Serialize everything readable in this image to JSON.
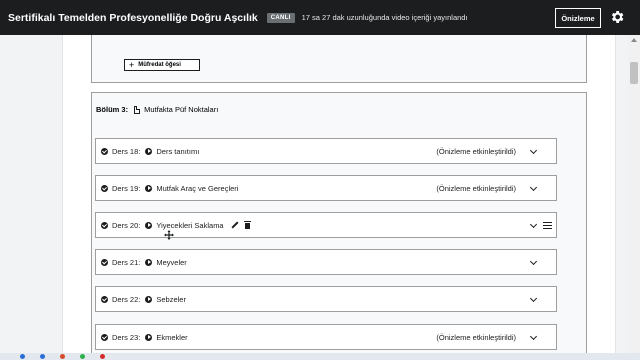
{
  "header": {
    "course_title": "Sertifikalı Temelden Profesyonelliğe Doğru Aşcılık",
    "live_badge": "CANLI",
    "status_text": "17 sa 27 dak uzunluğunda video içeriği yayınlandı",
    "preview_button": "Önizleme",
    "settings_icon": "gear-icon"
  },
  "curriculum": {
    "add_item_label": "Müfredat öğesi",
    "section": {
      "label": "Bölüm 3:",
      "title": "Mutfakta Püf Noktaları"
    },
    "lectures": [
      {
        "label": "Ders 18:",
        "title": "Ders tanıtımı",
        "preview_note": "(Önizleme etkinleştirildi)",
        "expanded_tools": false
      },
      {
        "label": "Ders 19:",
        "title": "Mutfak Araç ve Gereçleri",
        "preview_note": "(Önizleme etkinleştirildi)",
        "expanded_tools": false
      },
      {
        "label": "Ders 20:",
        "title": "Yiyecekleri Saklama",
        "preview_note": "",
        "expanded_tools": true
      },
      {
        "label": "Ders 21:",
        "title": "Meyveler",
        "preview_note": "",
        "expanded_tools": false
      },
      {
        "label": "Ders 22:",
        "title": "Sebzeler",
        "preview_note": "",
        "expanded_tools": false
      },
      {
        "label": "Ders 23:",
        "title": "Ekmekler",
        "preview_note": "(Önizleme etkinleştirildi)",
        "expanded_tools": false
      }
    ]
  }
}
